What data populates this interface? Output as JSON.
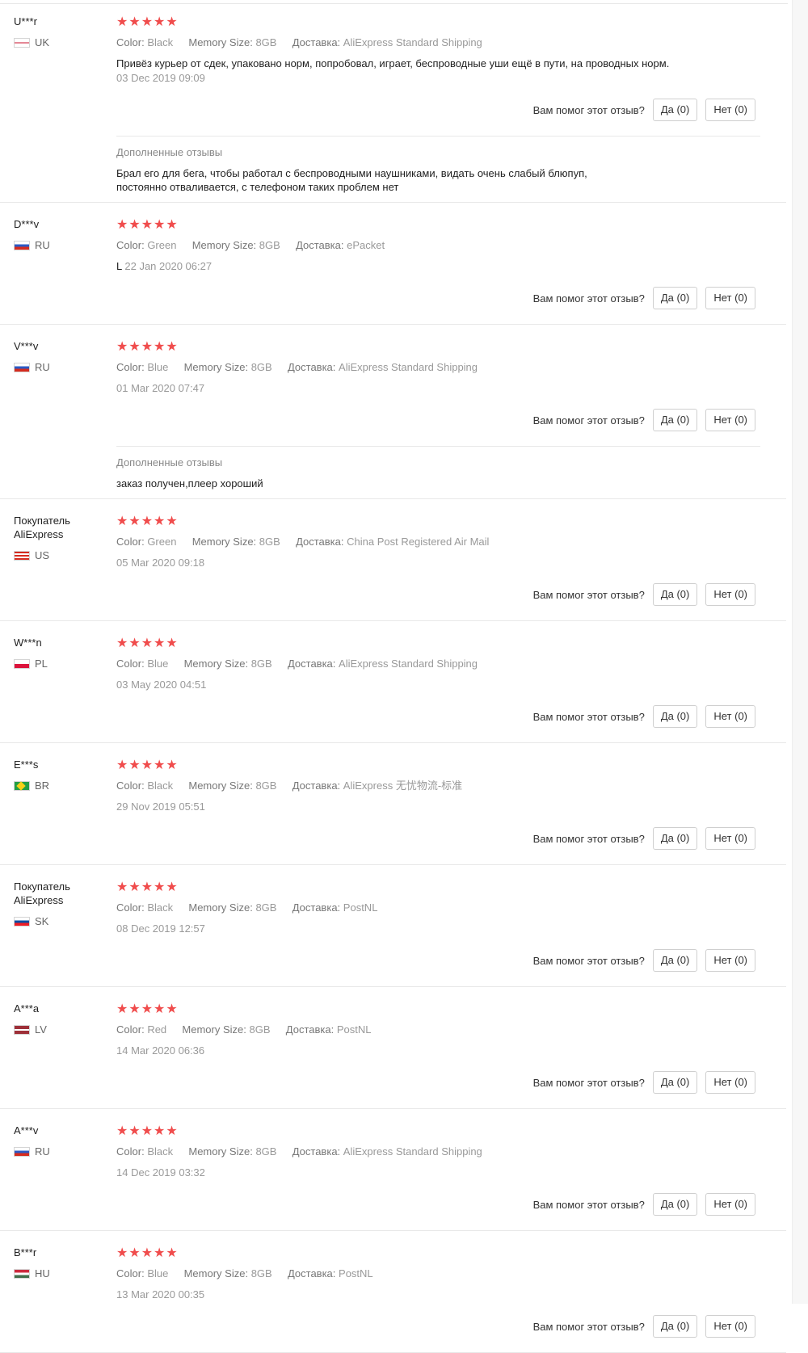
{
  "labels": {
    "color": "Color:",
    "memory": "Memory Size:",
    "shipping": "Доставка:",
    "helpful": "Вам помог этот отзыв?",
    "yes": "Да (0)",
    "no": "Нет (0)",
    "added_title": "Дополненные отзывы"
  },
  "star_glyphs": "★★★★★",
  "reviews": [
    {
      "user": "U***r",
      "country": "UK",
      "flag": "uk",
      "color": "Black",
      "memory": "8GB",
      "shipping": "AliExpress Standard Shipping",
      "text": "Привёз курьер от сдек, упаковано норм, попробовал, играет, беспроводные уши ещё в пути, на проводных норм.",
      "date": "03 Dec 2019 09:09",
      "added": "Брал его для бега, чтобы работал с беспроводными наушниками, видать очень слабый блюпуп, постоянно отваливается, с телефоном таких проблем нет"
    },
    {
      "user": "D***v",
      "country": "RU",
      "flag": "ru",
      "color": "Green",
      "memory": "8GB",
      "shipping": "ePacket",
      "text": "L",
      "date": "22 Jan 2020 06:27"
    },
    {
      "user": "V***v",
      "country": "RU",
      "flag": "ru",
      "color": "Blue",
      "memory": "8GB",
      "shipping": "AliExpress Standard Shipping",
      "text": "",
      "date": "01 Mar 2020 07:47",
      "added": "заказ получен,плеер хороший"
    },
    {
      "user": "Покупатель AliExpress",
      "country": "US",
      "flag": "us",
      "color": "Green",
      "memory": "8GB",
      "shipping": "China Post Registered Air Mail",
      "text": "",
      "date": "05 Mar 2020 09:18"
    },
    {
      "user": "W***n",
      "country": "PL",
      "flag": "pl",
      "color": "Blue",
      "memory": "8GB",
      "shipping": "AliExpress Standard Shipping",
      "text": "",
      "date": "03 May 2020 04:51"
    },
    {
      "user": "E***s",
      "country": "BR",
      "flag": "br",
      "color": "Black",
      "memory": "8GB",
      "shipping": "AliExpress 无忧物流-标准",
      "text": "",
      "date": "29 Nov 2019 05:51"
    },
    {
      "user": "Покупатель AliExpress",
      "country": "SK",
      "flag": "sk",
      "color": "Black",
      "memory": "8GB",
      "shipping": "PostNL",
      "text": "",
      "date": "08 Dec 2019 12:57"
    },
    {
      "user": "A***a",
      "country": "LV",
      "flag": "lv",
      "color": "Red",
      "memory": "8GB",
      "shipping": "PostNL",
      "text": "",
      "date": "14 Mar 2020 06:36"
    },
    {
      "user": "A***v",
      "country": "RU",
      "flag": "ru",
      "color": "Black",
      "memory": "8GB",
      "shipping": "AliExpress Standard Shipping",
      "text": "",
      "date": "14 Dec 2019 03:32"
    },
    {
      "user": "B***r",
      "country": "HU",
      "flag": "hu",
      "color": "Blue",
      "memory": "8GB",
      "shipping": "PostNL",
      "text": "",
      "date": "13 Mar 2020 00:35"
    }
  ]
}
